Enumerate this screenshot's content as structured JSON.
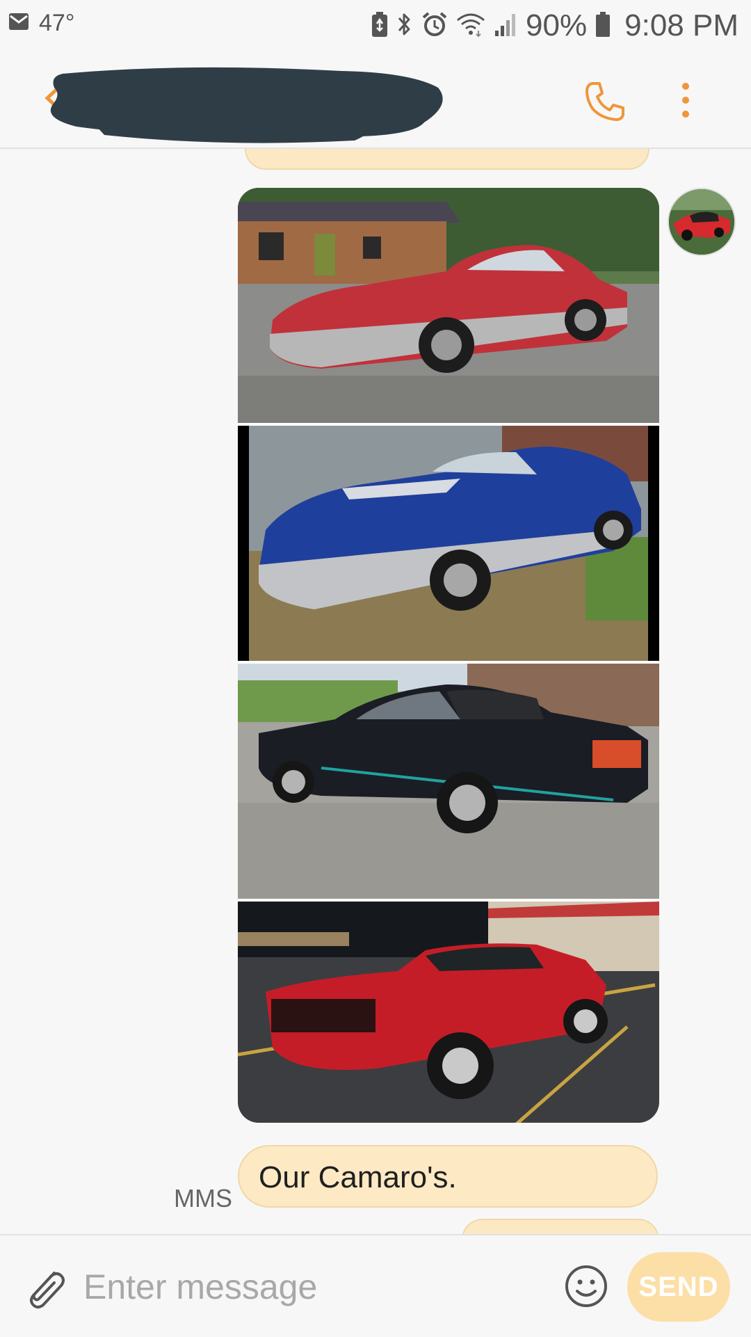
{
  "status_bar": {
    "notification_icon": "mail-icon",
    "weather": "47°",
    "icons": [
      "battery-saver-icon",
      "bluetooth-icon",
      "alarm-icon",
      "wifi-icon",
      "signal-icon"
    ],
    "battery_percent": "90%",
    "time": "9:08 PM"
  },
  "header": {
    "contact_name": "",
    "back_icon": "chevron-left-icon",
    "call_icon": "phone-icon",
    "more_icon": "more-vertical-icon",
    "accent_color": "#f0953a"
  },
  "conversation": {
    "avatar_icon": "contact-avatar",
    "photos": [
      {
        "description_icon": "red-camaro-photo"
      },
      {
        "description_icon": "blue-camaro-photo"
      },
      {
        "description_icon": "black-iroc-z-convertible-photo"
      },
      {
        "description_icon": "red-1967-camaro-photo"
      }
    ],
    "message": {
      "type_label": "MMS",
      "text": "Our Camaro's."
    },
    "bubble_color": "#fde9c3"
  },
  "composer": {
    "attach_icon": "paperclip-icon",
    "placeholder": "Enter message",
    "value": "",
    "emoji_icon": "smiley-icon",
    "send_label": "SEND",
    "send_color": "#fcdfa6"
  }
}
